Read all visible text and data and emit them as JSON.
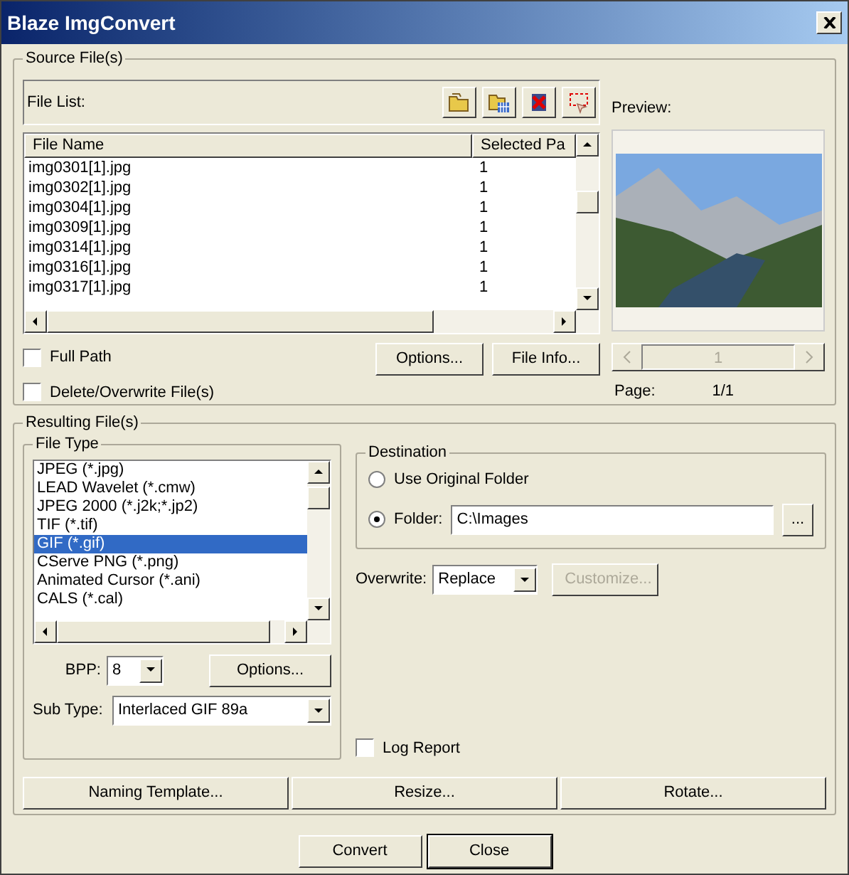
{
  "window": {
    "title": "Blaze ImgConvert"
  },
  "source": {
    "title": "Source File(s)",
    "file_list_label": "File List:",
    "columns": [
      "File Name",
      "Selected Pa"
    ],
    "rows": [
      {
        "name": "img0301[1].jpg",
        "pages": "1"
      },
      {
        "name": "img0302[1].jpg",
        "pages": "1"
      },
      {
        "name": "img0304[1].jpg",
        "pages": "1"
      },
      {
        "name": "img0309[1].jpg",
        "pages": "1"
      },
      {
        "name": "img0314[1].jpg",
        "pages": "1"
      },
      {
        "name": "img0316[1].jpg",
        "pages": "1"
      },
      {
        "name": "img0317[1].jpg",
        "pages": "1"
      }
    ],
    "checkboxes": [
      {
        "label": "Full Path",
        "checked": false
      },
      {
        "label": "Delete/Overwrite File(s)",
        "checked": false
      }
    ],
    "buttons": [
      "Options...",
      "File Info..."
    ],
    "preview": {
      "label": "Preview:",
      "page_number": "1",
      "page_label": "Page:",
      "page_value": "1/1"
    }
  },
  "result": {
    "title": "Resulting File(s)",
    "file_type": {
      "title": "File Type",
      "items": [
        {
          "label": "JPEG (*.jpg)",
          "selected": false
        },
        {
          "label": "LEAD Wavelet (*.cmw)",
          "selected": false
        },
        {
          "label": "JPEG 2000 (*.j2k;*.jp2)",
          "selected": false
        },
        {
          "label": "TIF (*.tif)",
          "selected": false
        },
        {
          "label": "GIF (*.gif)",
          "selected": true
        },
        {
          "label": "CServe PNG (*.png)",
          "selected": false
        },
        {
          "label": "Animated Cursor (*.ani)",
          "selected": false
        },
        {
          "label": "CALS (*.cal)",
          "selected": false
        }
      ],
      "bpp_label": "BPP:",
      "bpp_value": "8",
      "options_button": "Options...",
      "subtype_label": "Sub Type:",
      "subtype_value": "Interlaced GIF 89a"
    },
    "destination": {
      "title": "Destination",
      "options": [
        {
          "label": "Use Original Folder",
          "selected": false
        },
        {
          "label": "Folder:",
          "selected": true
        }
      ],
      "folder_value": "C:\\Images",
      "browse_button": "..."
    },
    "overwrite": {
      "label": "Overwrite:",
      "value": "Replace",
      "customize_button": "Customize...",
      "customize_disabled": true
    },
    "log_report": {
      "label": "Log Report",
      "checked": false
    },
    "buttons": [
      "Naming Template...",
      "Resize...",
      "Rotate..."
    ]
  },
  "footer_buttons": [
    "Convert",
    "Close"
  ]
}
